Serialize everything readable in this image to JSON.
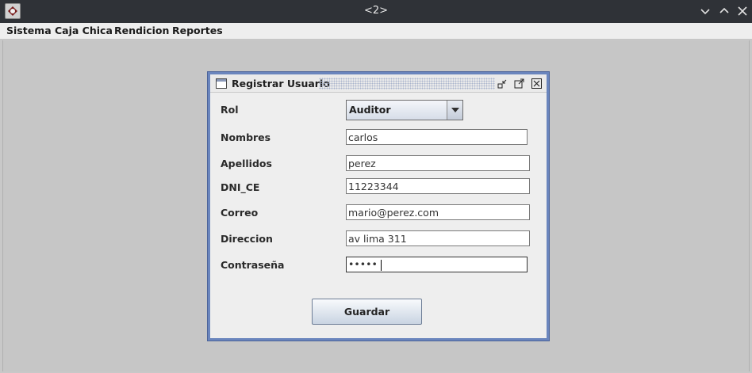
{
  "window": {
    "title": "<2>"
  },
  "menu": {
    "items": [
      "Sistema",
      "Caja Chica",
      "Rendicion",
      "Reportes"
    ]
  },
  "internal_frame": {
    "title": "Registrar Usuario",
    "form": {
      "rol_label": "Rol",
      "rol_value": "Auditor",
      "nombres_label": "Nombres",
      "nombres_value": "carlos",
      "apellidos_label": "Apellidos",
      "apellidos_value": "perez",
      "dni_label": "DNI_CE",
      "dni_value": "11223344",
      "correo_label": "Correo",
      "correo_value": "mario@perez.com",
      "direccion_label": "Direccion",
      "direccion_value": "av lima 311",
      "contrasena_label": "Contraseña",
      "contrasena_value": "•••••",
      "guardar_label": "Guardar"
    }
  },
  "icons": {
    "app": "app-icon",
    "window_controls": [
      "minimize-icon",
      "maximize-icon",
      "close-icon"
    ],
    "frame_controls": [
      "iconify-icon",
      "maximize-icon",
      "close-icon"
    ]
  },
  "colors": {
    "titlebar": "#2f3237",
    "frame_border": "#6a85bd",
    "desktop": "#c6c6c6"
  }
}
